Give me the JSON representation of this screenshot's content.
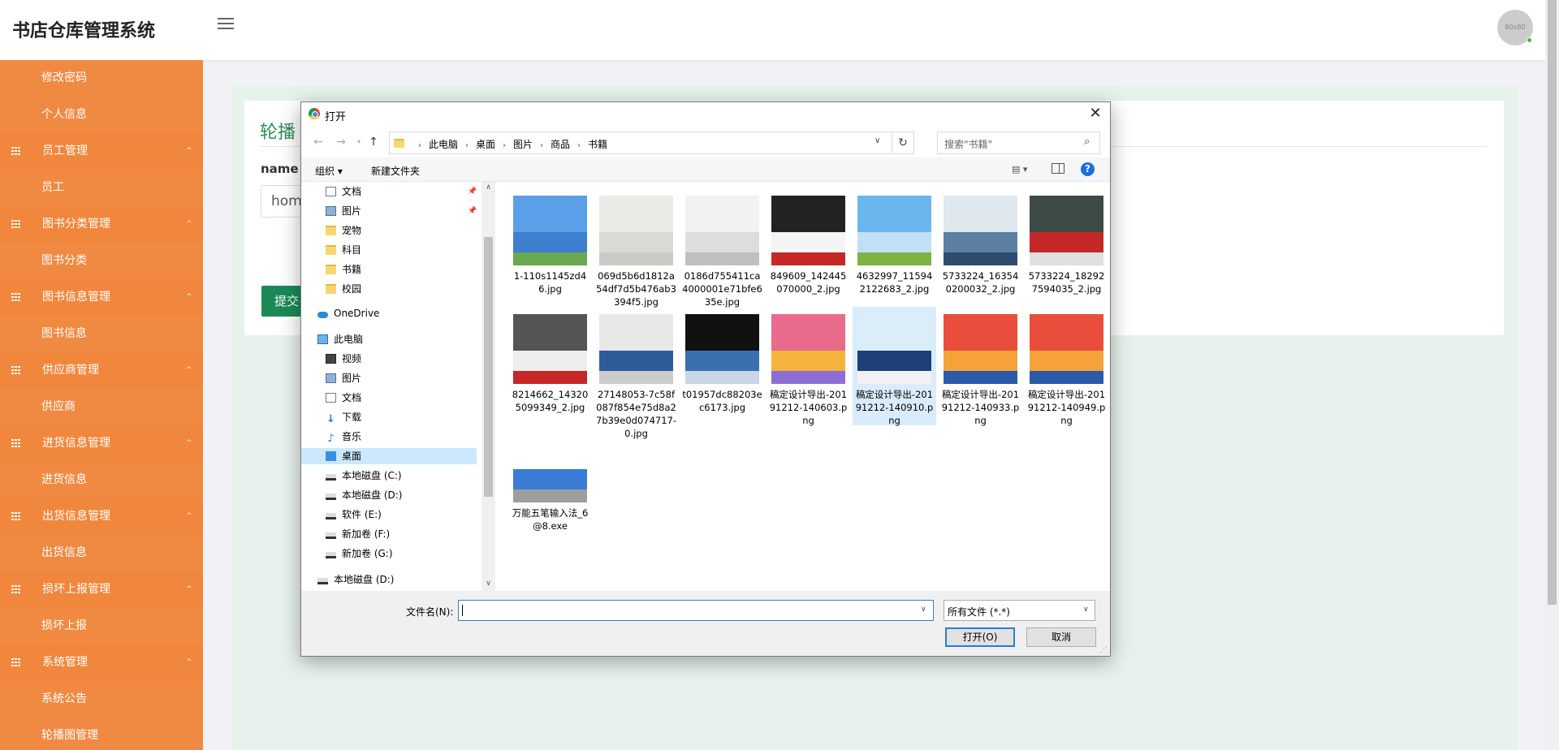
{
  "app": {
    "title": "书店仓库管理系统",
    "avatar_text": "80x80"
  },
  "sidebar": {
    "items": [
      {
        "label": "修改密码",
        "type": "child"
      },
      {
        "label": "个人信息",
        "type": "child"
      },
      {
        "label": "员工管理",
        "type": "group"
      },
      {
        "label": "员工",
        "type": "child"
      },
      {
        "label": "图书分类管理",
        "type": "group"
      },
      {
        "label": "图书分类",
        "type": "child"
      },
      {
        "label": "图书信息管理",
        "type": "group"
      },
      {
        "label": "图书信息",
        "type": "child"
      },
      {
        "label": "供应商管理",
        "type": "group"
      },
      {
        "label": "供应商",
        "type": "child"
      },
      {
        "label": "进货信息管理",
        "type": "group"
      },
      {
        "label": "进货信息",
        "type": "child"
      },
      {
        "label": "出货信息管理",
        "type": "group"
      },
      {
        "label": "出货信息",
        "type": "child"
      },
      {
        "label": "损坏上报管理",
        "type": "group"
      },
      {
        "label": "损坏上报",
        "type": "child"
      },
      {
        "label": "系统管理",
        "type": "group"
      },
      {
        "label": "系统公告",
        "type": "child"
      },
      {
        "label": "轮播图管理",
        "type": "child"
      }
    ],
    "caret": "^"
  },
  "main": {
    "card_title": "轮播",
    "field_label": "name",
    "field_value": "hom",
    "submit_label": "提交"
  },
  "dialog": {
    "title": "打开",
    "close": "✕",
    "breadcrumbs": [
      "此电脑",
      "桌面",
      "图片",
      "商品",
      "书籍"
    ],
    "search_placeholder": "搜索\"书籍\"",
    "toolbar": {
      "organize": "组织 ▾",
      "new_folder": "新建文件夹",
      "help": "?"
    },
    "nav_items": [
      {
        "label": "文档",
        "icon": "ic-doc",
        "pinned": true
      },
      {
        "label": "图片",
        "icon": "ic-pic",
        "pinned": true
      },
      {
        "label": "宠物",
        "icon": "ic-folder"
      },
      {
        "label": "科目",
        "icon": "ic-folder"
      },
      {
        "label": "书籍",
        "icon": "ic-folder"
      },
      {
        "label": "校园",
        "icon": "ic-folder"
      },
      {
        "label": "OneDrive",
        "icon": "ic-cloud"
      },
      {
        "label": "此电脑",
        "icon": "ic-pc"
      },
      {
        "label": "视频",
        "icon": "ic-vid"
      },
      {
        "label": "图片",
        "icon": "ic-pic"
      },
      {
        "label": "文档",
        "icon": "ic-doc"
      },
      {
        "label": "下载",
        "icon": "ic-down"
      },
      {
        "label": "音乐",
        "icon": "ic-music"
      },
      {
        "label": "桌面",
        "icon": "ic-desk",
        "selected": true
      },
      {
        "label": "本地磁盘 (C:)",
        "icon": "ic-drive"
      },
      {
        "label": "本地磁盘 (D:)",
        "icon": "ic-drive"
      },
      {
        "label": "软件 (E:)",
        "icon": "ic-drive"
      },
      {
        "label": "新加卷 (F:)",
        "icon": "ic-drive"
      },
      {
        "label": "新加卷 (G:)",
        "icon": "ic-drive"
      },
      {
        "label": "本地磁盘 (D:)",
        "icon": "ic-drive"
      }
    ],
    "files": [
      {
        "name": "1-110s1145zd46.jpg",
        "colors": [
          "#5aa0e8",
          "#3f7fcf",
          "#6aa84f"
        ]
      },
      {
        "name": "069d5b6d1812a54df7d5b476ab3394f5.jpg",
        "colors": [
          "#e9ebe6",
          "#d8dbd5",
          "#c9ccc6"
        ]
      },
      {
        "name": "0186d755411ca4000001e71bfe635e.jpg",
        "colors": [
          "#f2f2f2",
          "#dddddd",
          "#c0c0c0"
        ]
      },
      {
        "name": "849609_142445070000_2.jpg",
        "colors": [
          "#222222",
          "#f4f4f4",
          "#c62828"
        ]
      },
      {
        "name": "4632997_115942122683_2.jpg",
        "colors": [
          "#6cb6ee",
          "#bfe0f7",
          "#7cb342"
        ]
      },
      {
        "name": "5733224_163540200032_2.jpg",
        "colors": [
          "#dfe7ef",
          "#5d7fa3",
          "#2e4c6d"
        ]
      },
      {
        "name": "5733224_182927594035_2.jpg",
        "colors": [
          "#3e4a46",
          "#c62828",
          "#e0e0e0"
        ]
      },
      {
        "name": "8214662_143205099349_2.jpg",
        "colors": [
          "#555555",
          "#eeeeee",
          "#c62828"
        ]
      },
      {
        "name": "27148053-7c58f087f854e75d8a27b39e0d074717-0.jpg",
        "colors": [
          "#e8e8e8",
          "#2e5b9a",
          "#cccccc"
        ]
      },
      {
        "name": "t01957dc88203ec6173.jpg",
        "colors": [
          "#111111",
          "#3a6fb0",
          "#c8d6e8"
        ]
      },
      {
        "name": "稿定设计导出-20191212-140603.png",
        "colors": [
          "#e86b8c",
          "#f3b33c",
          "#8c6fd6"
        ]
      },
      {
        "name": "稿定设计导出-20191212-140910.png",
        "colors": [
          "#dbeef8",
          "#1f3f7a",
          "#f2f2f2"
        ]
      },
      {
        "name": "稿定设计导出-20191212-140933.png",
        "colors": [
          "#e94e3c",
          "#f6a23b",
          "#2b5aa8"
        ]
      },
      {
        "name": "稿定设计导出-20191212-140949.png",
        "colors": [
          "#e94e3c",
          "#f6a23b",
          "#2b5aa8"
        ]
      },
      {
        "name": "万能五笔输入法_6@8.exe",
        "colors": [
          "#ffffff",
          "#3a7bd5",
          "#9e9e9e"
        ]
      }
    ],
    "filename_label": "文件名(N):",
    "filename_value": "",
    "filetype_value": "所有文件 (*.*)",
    "open_label": "打开(O)",
    "cancel_label": "取消"
  }
}
